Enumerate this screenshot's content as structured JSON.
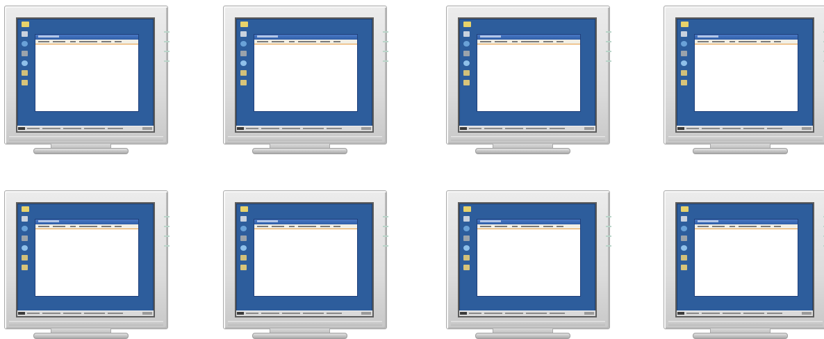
{
  "monitors": [
    {
      "id": 1
    },
    {
      "id": 2
    },
    {
      "id": 3
    },
    {
      "id": 4
    },
    {
      "id": 5
    },
    {
      "id": 6
    },
    {
      "id": 7
    },
    {
      "id": 8
    }
  ],
  "colors": {
    "desktop": "#2d5d9c",
    "bezel": "#dcdcdc",
    "window": "#ffffff",
    "titlebar": "#2f5ea8",
    "toolbar_rule": "#e59a3c"
  },
  "desktop_icons": [
    "folder-icon",
    "computer-icon",
    "globe-icon",
    "printer-icon",
    "search-icon",
    "mail-icon",
    "document-icon"
  ]
}
